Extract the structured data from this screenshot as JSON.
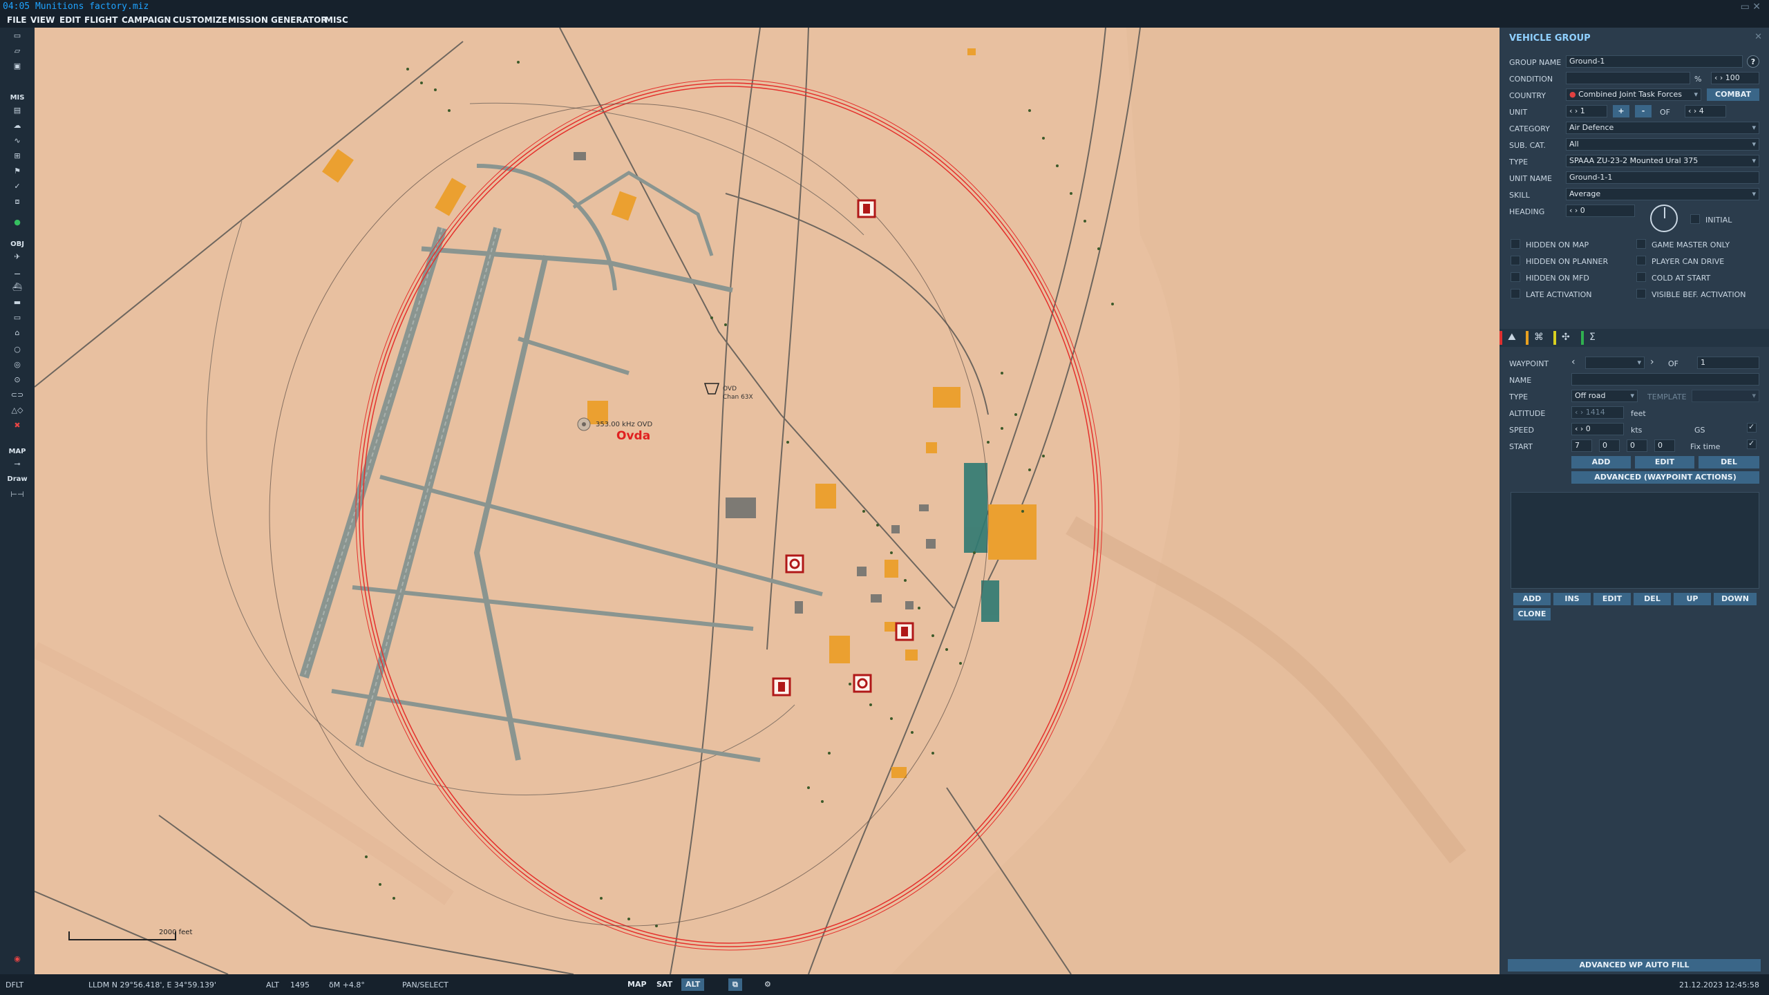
{
  "app": {
    "title": "04:05 Munitions factory.miz"
  },
  "menu": [
    "FILE",
    "VIEW",
    "EDIT",
    "FLIGHT",
    "CAMPAIGN",
    "CUSTOMIZE",
    "MISSION GENERATOR",
    "MISC"
  ],
  "toolbar": {
    "mis_label": "MIS",
    "obj_label": "OBJ",
    "map_label": "MAP",
    "draw_label": "Draw"
  },
  "map": {
    "airfield_name": "Ovda",
    "ndb_label": "353.00 kHz OVD",
    "tacan_label": "OVD",
    "tacan_channel": "Chan 63X",
    "scale_label": "2000 feet"
  },
  "panel": {
    "title": "VEHICLE GROUP",
    "group_name_label": "GROUP NAME",
    "group_name": "Ground-1",
    "condition_label": "CONDITION",
    "condition_pct": "%",
    "condition_value": "100",
    "country_label": "COUNTRY",
    "country": "Combined Joint Task Forces",
    "combat": "COMBAT",
    "unit_label": "UNIT",
    "unit_value": "1",
    "unit_of": "OF",
    "unit_total": "4",
    "category_label": "CATEGORY",
    "category": "Air Defence",
    "subcat_label": "SUB. CAT.",
    "subcat": "All",
    "type_label": "TYPE",
    "type": "SPAAA ZU-23-2 Mounted Ural 375",
    "unit_name_label": "UNIT NAME",
    "unit_name": "Ground-1-1",
    "skill_label": "SKILL",
    "skill": "Average",
    "heading_label": "HEADING",
    "heading": "0",
    "initial_label": "INITIAL",
    "checks_left": [
      "HIDDEN ON MAP",
      "HIDDEN ON PLANNER",
      "HIDDEN ON MFD",
      "LATE ACTIVATION"
    ],
    "checks_right": [
      "GAME MASTER ONLY",
      "PLAYER CAN DRIVE",
      "COLD AT START",
      "VISIBLE BEF. ACTIVATION"
    ],
    "waypoint_label": "WAYPOINT",
    "wp_of": "OF",
    "wp_total": "1",
    "name_label": "NAME",
    "wp_type_label": "TYPE",
    "wp_type": "Off road",
    "template_label": "TEMPLATE",
    "altitude_label": "ALTITUDE",
    "altitude_value": "1414",
    "altitude_unit": "feet",
    "speed_label": "SPEED",
    "speed_value": "0",
    "speed_unit": "kts",
    "gs_label": "GS",
    "start_label": "START",
    "start_d": "7",
    "start_h": "0",
    "start_m": "0",
    "start_s": "0",
    "fix_time_label": "Fix time",
    "wp_btns": [
      "ADD",
      "EDIT",
      "DEL"
    ],
    "adv_wp_actions": "ADVANCED (WAYPOINT ACTIONS)",
    "list_btns": [
      "ADD",
      "INS",
      "EDIT",
      "DEL",
      "UP",
      "DOWN"
    ],
    "clone": "CLONE",
    "adv_wp_autofill": "ADVANCED WP AUTO FILL",
    "datetime": "21.12.2023 12:45:58"
  },
  "status": {
    "profile": "DFLT",
    "coords": "LLDM  N 29°56.418', E 34°59.139'",
    "alt_label": "ALT",
    "alt_value": "1495",
    "magvar": "δM  +4.8°",
    "mode": "PAN/SELECT",
    "map_btn": "MAP",
    "sat_btn": "SAT",
    "alt_btn": "ALT"
  }
}
